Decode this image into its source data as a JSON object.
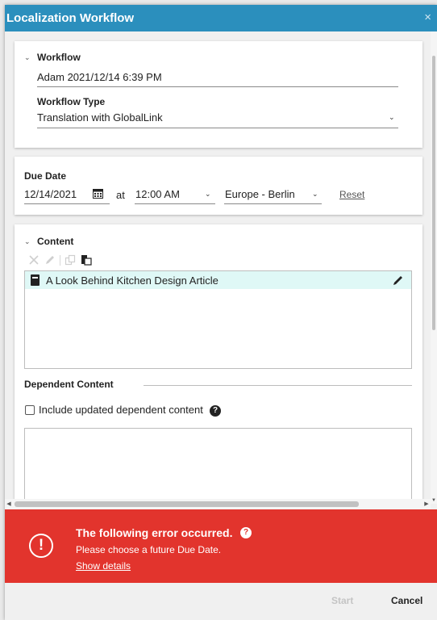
{
  "dialog": {
    "title": "Localization Workflow",
    "close_glyph": "×"
  },
  "workflow": {
    "section_label": "Workflow",
    "name_value": "Adam 2021/12/14 6:39 PM",
    "type_label": "Workflow Type",
    "type_value": "Translation with GlobalLink"
  },
  "due": {
    "section_label": "Due Date",
    "date_value": "12/14/2021",
    "at_label": "at",
    "time_value": "12:00 AM",
    "timezone_value": "Europe - Berlin",
    "reset_label": "Reset"
  },
  "content": {
    "section_label": "Content",
    "items": [
      {
        "label": "A Look Behind Kitchen Design Article"
      }
    ],
    "dependent_label": "Dependent Content",
    "include_label": "Include updated dependent content"
  },
  "error": {
    "title": "The following error occurred.",
    "icon_glyph": "!",
    "help_glyph": "?",
    "message": "Please choose a future Due Date.",
    "details_link": "Show details"
  },
  "footer": {
    "start_label": "Start",
    "cancel_label": "Cancel"
  },
  "colors": {
    "title_bar": "#2b8fbd",
    "error_bg": "#e2342d",
    "selected_row": "#dff8f6"
  }
}
